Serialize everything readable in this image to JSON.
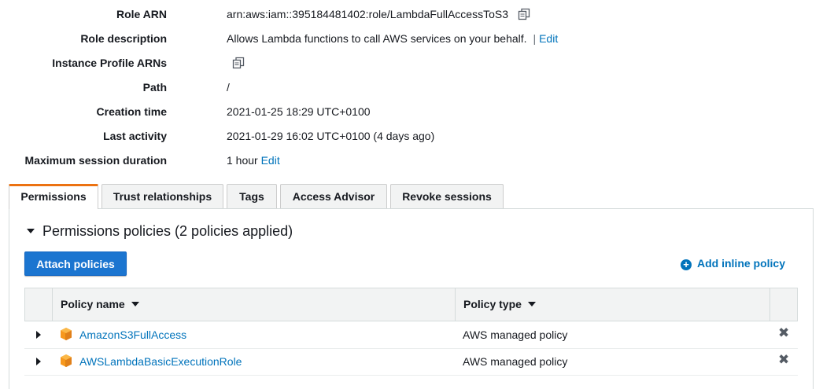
{
  "summary": {
    "role_arn": {
      "label": "Role ARN",
      "value": "arn:aws:iam::395184481402:role/LambdaFullAccessToS3"
    },
    "role_description": {
      "label": "Role description",
      "value": "Allows Lambda functions to call AWS services on your behalf.",
      "separator": "|",
      "edit": "Edit"
    },
    "instance_profile_arns": {
      "label": "Instance Profile ARNs"
    },
    "path": {
      "label": "Path",
      "value": "/"
    },
    "creation_time": {
      "label": "Creation time",
      "value": "2021-01-25 18:29 UTC+0100"
    },
    "last_activity": {
      "label": "Last activity",
      "value": "2021-01-29 16:02 UTC+0100 (4 days ago)"
    },
    "max_session_duration": {
      "label": "Maximum session duration",
      "value": "1 hour",
      "edit": "Edit"
    }
  },
  "tabs": [
    {
      "label": "Permissions",
      "active": true
    },
    {
      "label": "Trust relationships",
      "active": false
    },
    {
      "label": "Tags",
      "active": false
    },
    {
      "label": "Access Advisor",
      "active": false
    },
    {
      "label": "Revoke sessions",
      "active": false
    }
  ],
  "permissions": {
    "section_title": "Permissions policies (2 policies applied)",
    "attach_button": "Attach policies",
    "add_inline": "Add inline policy",
    "columns": [
      "Policy name",
      "Policy type"
    ],
    "policies": [
      {
        "name": "AmazonS3FullAccess",
        "type": "AWS managed policy"
      },
      {
        "name": "AWSLambdaBasicExecutionRole",
        "type": "AWS managed policy"
      }
    ]
  },
  "colors": {
    "link": "#0073bb",
    "primary_button": "#1b75d0",
    "active_tab_accent": "#ec7211",
    "policy_icon": "#f7981d",
    "header_bg": "#f2f3f3"
  },
  "icons": {
    "copy": "copy-icon",
    "policy": "policy-cube-icon",
    "remove": "remove-x-icon",
    "add": "plus-circle-icon",
    "expand": "caret-right-icon",
    "collapse": "caret-down-icon",
    "sort": "sort-caret-icon"
  }
}
